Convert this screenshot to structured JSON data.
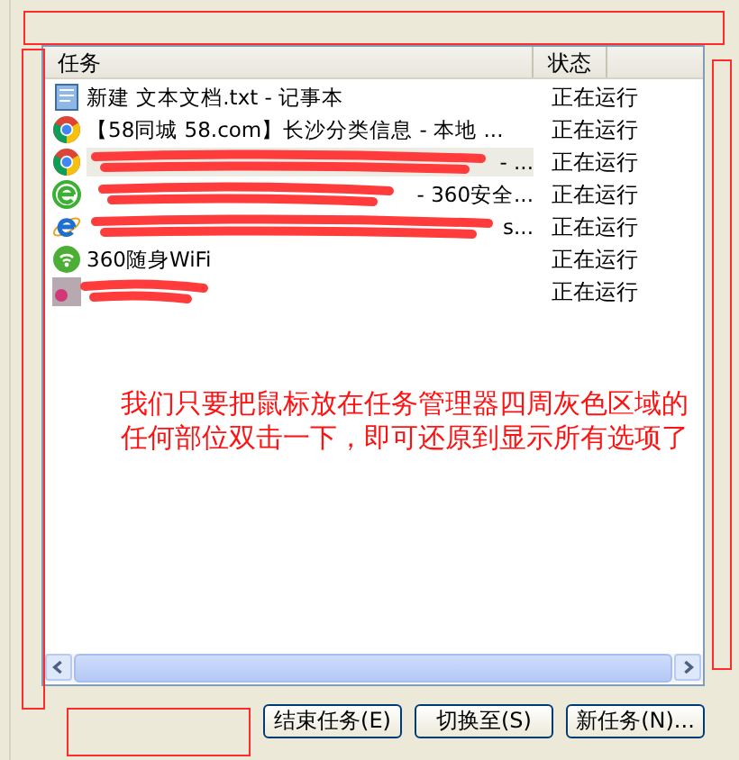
{
  "columns": [
    "任务",
    "状态"
  ],
  "rows": [
    {
      "task": "新建 文本文档.txt - 记事本",
      "status": "正在运行",
      "selected": false,
      "redacted": false
    },
    {
      "task": "【58同城 58.com】长沙分类信息 - 本地 ...",
      "status": "正在运行",
      "selected": false,
      "redacted": false
    },
    {
      "task": "- ...",
      "status": "正在运行",
      "selected": true,
      "redacted": true
    },
    {
      "task": "- 360安全...",
      "status": "正在运行",
      "selected": false,
      "redacted": true
    },
    {
      "task": "s...",
      "status": "正在运行",
      "selected": false,
      "redacted": true
    },
    {
      "task": "360随身WiFi",
      "status": "正在运行",
      "selected": false,
      "redacted": false
    },
    {
      "task": "",
      "status": "正在运行",
      "selected": false,
      "redacted": true
    }
  ],
  "annotation": "我们只要把鼠标放在任务管理器四周灰色区域的任何部位双击一下，即可还原到显示所有选项了",
  "buttons": [
    "结束任务(E)",
    "切换至(S)",
    "新任务(N)..."
  ]
}
